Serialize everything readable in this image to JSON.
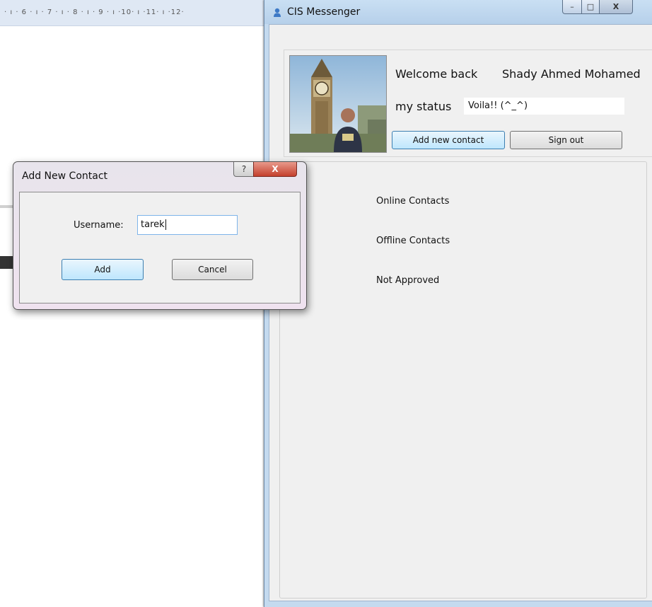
{
  "background": {
    "ruler_text": "· ı · 6 · ı · 7 · ı · 8 · ı · 9 · ı ·10· ı ·11· ı ·12·"
  },
  "window": {
    "title": "CIS Messenger",
    "controls": {
      "minimize": "–",
      "maximize": "□",
      "close": "X"
    }
  },
  "profile": {
    "welcome_label": "Welcome back",
    "user_name": "Shady Ahmed Mohamed",
    "status_label": "my status",
    "status_value": "Voila!! (^_^)",
    "add_contact_label": "Add new contact",
    "sign_out_label": "Sign out"
  },
  "contacts": {
    "groups": [
      "Online Contacts",
      "Offline Contacts",
      "Not Approved"
    ]
  },
  "dialog": {
    "title": "Add New Contact",
    "help": "?",
    "close": "X",
    "username_label": "Username:",
    "username_value": "tarek",
    "add_label": "Add",
    "cancel_label": "Cancel"
  },
  "icons": {
    "app": "messenger-person-icon",
    "avatar": "user-photo"
  },
  "colors": {
    "titlebar": "#c4daef",
    "accent_button": "#bee6fd",
    "dialog_close": "#c4402d"
  }
}
